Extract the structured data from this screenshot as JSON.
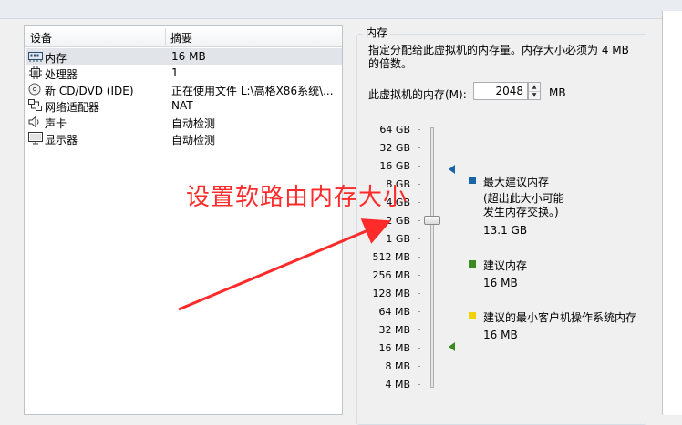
{
  "devices": {
    "header_device": "设备",
    "header_summary": "摘要",
    "rows": [
      {
        "name": "内存",
        "summary": "16 MB",
        "icon": "memory-icon"
      },
      {
        "name": "处理器",
        "summary": "1",
        "icon": "cpu-icon"
      },
      {
        "name": "新 CD/DVD (IDE)",
        "summary": "正在使用文件 L:\\高格X86系统\\...",
        "icon": "cd-dvd-icon"
      },
      {
        "name": "网络适配器",
        "summary": "NAT",
        "icon": "network-adapter-icon"
      },
      {
        "name": "声卡",
        "summary": "自动检测",
        "icon": "speaker-icon"
      },
      {
        "name": "显示器",
        "summary": "自动检测",
        "icon": "monitor-icon"
      }
    ]
  },
  "memory": {
    "group_title": "内存",
    "description": "指定分配给此虚拟机的内存量。内存大小必须为 4 MB 的倍数。",
    "input_label": "此虚拟机的内存(M):",
    "input_value": "2048",
    "unit": "MB",
    "slider_value": "2 GB",
    "scale": [
      "64 GB",
      "32 GB",
      "16 GB",
      "8 GB",
      "4 GB",
      "2 GB",
      "1 GB",
      "512 MB",
      "256 MB",
      "128 MB",
      "64 MB",
      "32 MB",
      "16 MB",
      "8 MB",
      "4 MB"
    ],
    "legend": {
      "max_title": "最大建议内存",
      "max_note": "(超出此大小可能\n发生内存交换。)",
      "max_value": "13.1 GB",
      "rec_title": "建议内存",
      "rec_value": "16 MB",
      "min_title": "建议的最小客户机操作系统内存",
      "min_value": "16 MB"
    },
    "colors": {
      "max": "#1a64a8",
      "recommended": "#3a8a1f",
      "minimum": "#f2d200"
    }
  },
  "annotation": {
    "text": "设置软路由内存大小",
    "color": "#ff2a2a"
  }
}
